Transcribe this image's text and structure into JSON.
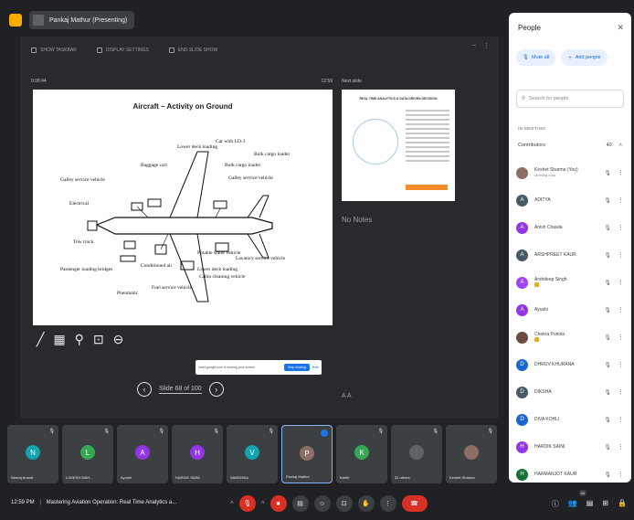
{
  "header": {
    "presenter_chip": "Pankaj Mathur (Presenting)"
  },
  "slideshow_toolbar": {
    "items": [
      "SHOW TASKBAR",
      "DISPLAY SETTINGS",
      "END SLIDE SHOW"
    ]
  },
  "presenter_view": {
    "timer": "0:06:44",
    "clock": "12:59",
    "next_label": "Next slide",
    "notes": "No Notes",
    "pager_label": "Slide 68 of 100"
  },
  "current_slide": {
    "title": "Aircraft – Activity on Ground",
    "labels": [
      "Lower deck loading",
      "Car with LD-3",
      "Bulk cargo loader",
      "Baggage cart",
      "Galley service vehicle",
      "Galley service vehicle",
      "Bulk cargo loader",
      "Electrical",
      "Tow truck",
      "Passenger loading bridges",
      "Potable water vehicle",
      "Lavatory service vehicle",
      "Cabin cleaning vehicle",
      "Fuel service vehicle",
      "Pneumatic",
      "Conditioned air",
      "Lower deck loading"
    ]
  },
  "next_slide": {
    "title": "REAL TIME ANALYTICS & DATA DRIVEN DECISION"
  },
  "toast": {
    "message": "meet.google.com is sharing your screen",
    "stop_label": "Stop sharing",
    "hide_label": "Hide"
  },
  "people_panel": {
    "title": "People",
    "mute_all": "Mute all",
    "add_people": "Add people",
    "search_placeholder": "Search for people",
    "section_label": "IN MEETING",
    "contributors_label": "Contributors",
    "contributors_count": "40",
    "members": [
      {
        "initial": "",
        "name": "Keshet Sharma (You)",
        "sub": "Meeting host",
        "color": "#8d6e63",
        "photo": true
      },
      {
        "initial": "A",
        "name": "ADITYA",
        "sub": "",
        "color": "#455a64"
      },
      {
        "initial": "A",
        "name": "Anish Chawla",
        "sub": "",
        "color": "#9334e6"
      },
      {
        "initial": "A",
        "name": "ARSHPREET KAUR",
        "sub": "",
        "color": "#455a64"
      },
      {
        "initial": "A",
        "name": "Arshdeep Singh",
        "sub": "",
        "color": "#a142f4",
        "hand": true
      },
      {
        "initial": "A",
        "name": "Ayushi",
        "sub": "",
        "color": "#9334e6"
      },
      {
        "initial": "",
        "name": "Chetna Puriola",
        "sub": "",
        "color": "#6d4c41",
        "photo": true,
        "hand": true
      },
      {
        "initial": "D",
        "name": "DHRUV KHURANA",
        "sub": "",
        "color": "#1967d2"
      },
      {
        "initial": "D",
        "name": "DIKSHA",
        "sub": "",
        "color": "#455a64"
      },
      {
        "initial": "D",
        "name": "DIVA KOHLI",
        "sub": "",
        "color": "#1967d2"
      },
      {
        "initial": "H",
        "name": "HARDIK SAINI",
        "sub": "",
        "color": "#9334e6"
      },
      {
        "initial": "H",
        "name": "HARMANJOT KAUR",
        "sub": "",
        "color": "#137333"
      }
    ]
  },
  "filmstrip": [
    {
      "initial": "N",
      "name": "Neeraj Anand",
      "color": "#12a4af"
    },
    {
      "initial": "L",
      "name": "LOKESH MAH...",
      "color": "#34a853"
    },
    {
      "initial": "A",
      "name": "Ayushi",
      "color": "#9334e6"
    },
    {
      "initial": "H",
      "name": "HARDIK SAINI",
      "color": "#9334e6"
    },
    {
      "initial": "V",
      "name": "VANSHIKA",
      "color": "#12a4af"
    },
    {
      "initial": "P",
      "name": "Pankaj Mathur",
      "color": "#8d6e63",
      "active": true
    },
    {
      "initial": "K",
      "name": "Kartik",
      "color": "#34a853"
    },
    {
      "initial": "",
      "name": "31 others",
      "color": "#5f6368"
    },
    {
      "initial": "",
      "name": "Keshet Sharma",
      "color": "#8d6e63"
    }
  ],
  "bottom_bar": {
    "clock": "12:59 PM",
    "meeting_title": "Mastering Aviation Operation: Real Time Analytics a...",
    "participant_count": "40"
  },
  "colors": {
    "accent": "#1a73e8",
    "danger": "#d93025",
    "surface": "#202124"
  }
}
